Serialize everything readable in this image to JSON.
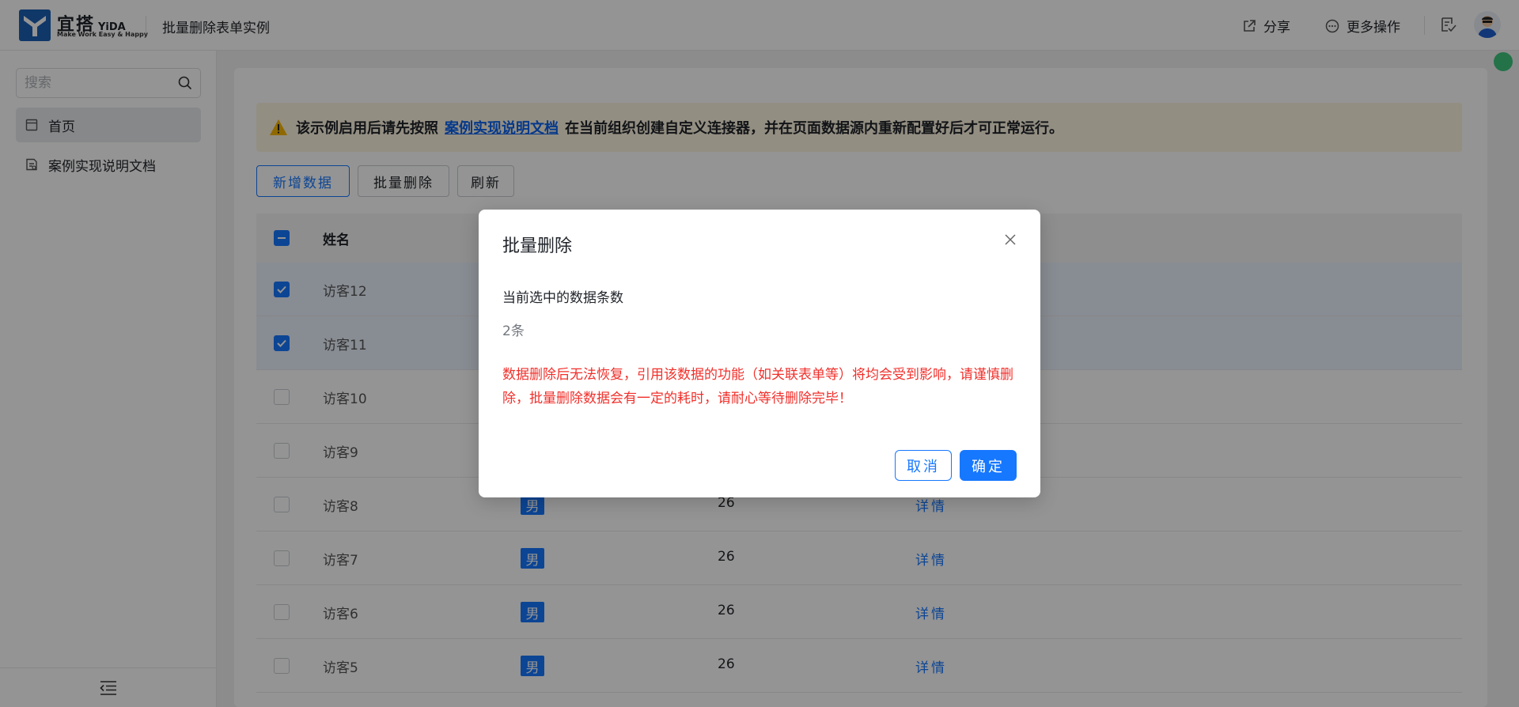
{
  "header": {
    "brand_cn": "宜搭",
    "brand_en": "YiDA",
    "brand_slogan": "Make Work Easy & Happy",
    "app_title": "批量删除表单实例",
    "share_label": "分享",
    "more_label": "更多操作"
  },
  "sidebar": {
    "search_placeholder": "搜索",
    "items": [
      {
        "label": "首页",
        "icon": "page-icon",
        "active": true
      },
      {
        "label": "案例实现说明文档",
        "icon": "doc-icon",
        "active": false
      }
    ]
  },
  "notice": {
    "prefix": "该示例启用后请先按照",
    "link": "案例实现说明文档",
    "suffix": "在当前组织创建自定义连接器，并在页面数据源内重新配置好后才可正常运行。"
  },
  "toolbar": {
    "add_label": "新增数据",
    "batch_delete_label": "批量删除",
    "refresh_label": "刷新"
  },
  "table": {
    "headers": {
      "name": "姓名"
    },
    "rows": [
      {
        "name": "访客12",
        "checked": true
      },
      {
        "name": "访客11",
        "checked": true
      },
      {
        "name": "访客10",
        "checked": false
      },
      {
        "name": "访客9",
        "checked": false
      },
      {
        "name": "访客8",
        "checked": false,
        "gender": "男",
        "age": "26",
        "action": "详情"
      },
      {
        "name": "访客7",
        "checked": false,
        "gender": "男",
        "age": "26",
        "action": "详情"
      },
      {
        "name": "访客6",
        "checked": false,
        "gender": "男",
        "age": "26",
        "action": "详情"
      },
      {
        "name": "访客5",
        "checked": false,
        "gender": "男",
        "age": "26",
        "action": "详情"
      }
    ]
  },
  "dialog": {
    "title": "批量删除",
    "count_label": "当前选中的数据条数",
    "count_value": "2条",
    "warning": "数据删除后无法恢复，引用该数据的功能（如关联表单等）将均会受到影响，请谨慎删除，批量删除数据会有一定的耗时，请耐心等待删除完毕！",
    "cancel_label": "取消",
    "ok_label": "确定"
  },
  "colors": {
    "primary": "#1677ff",
    "warning_text": "#f0302b",
    "notice_bg": "#fdf4e0",
    "brand": "#1a5fb4"
  }
}
